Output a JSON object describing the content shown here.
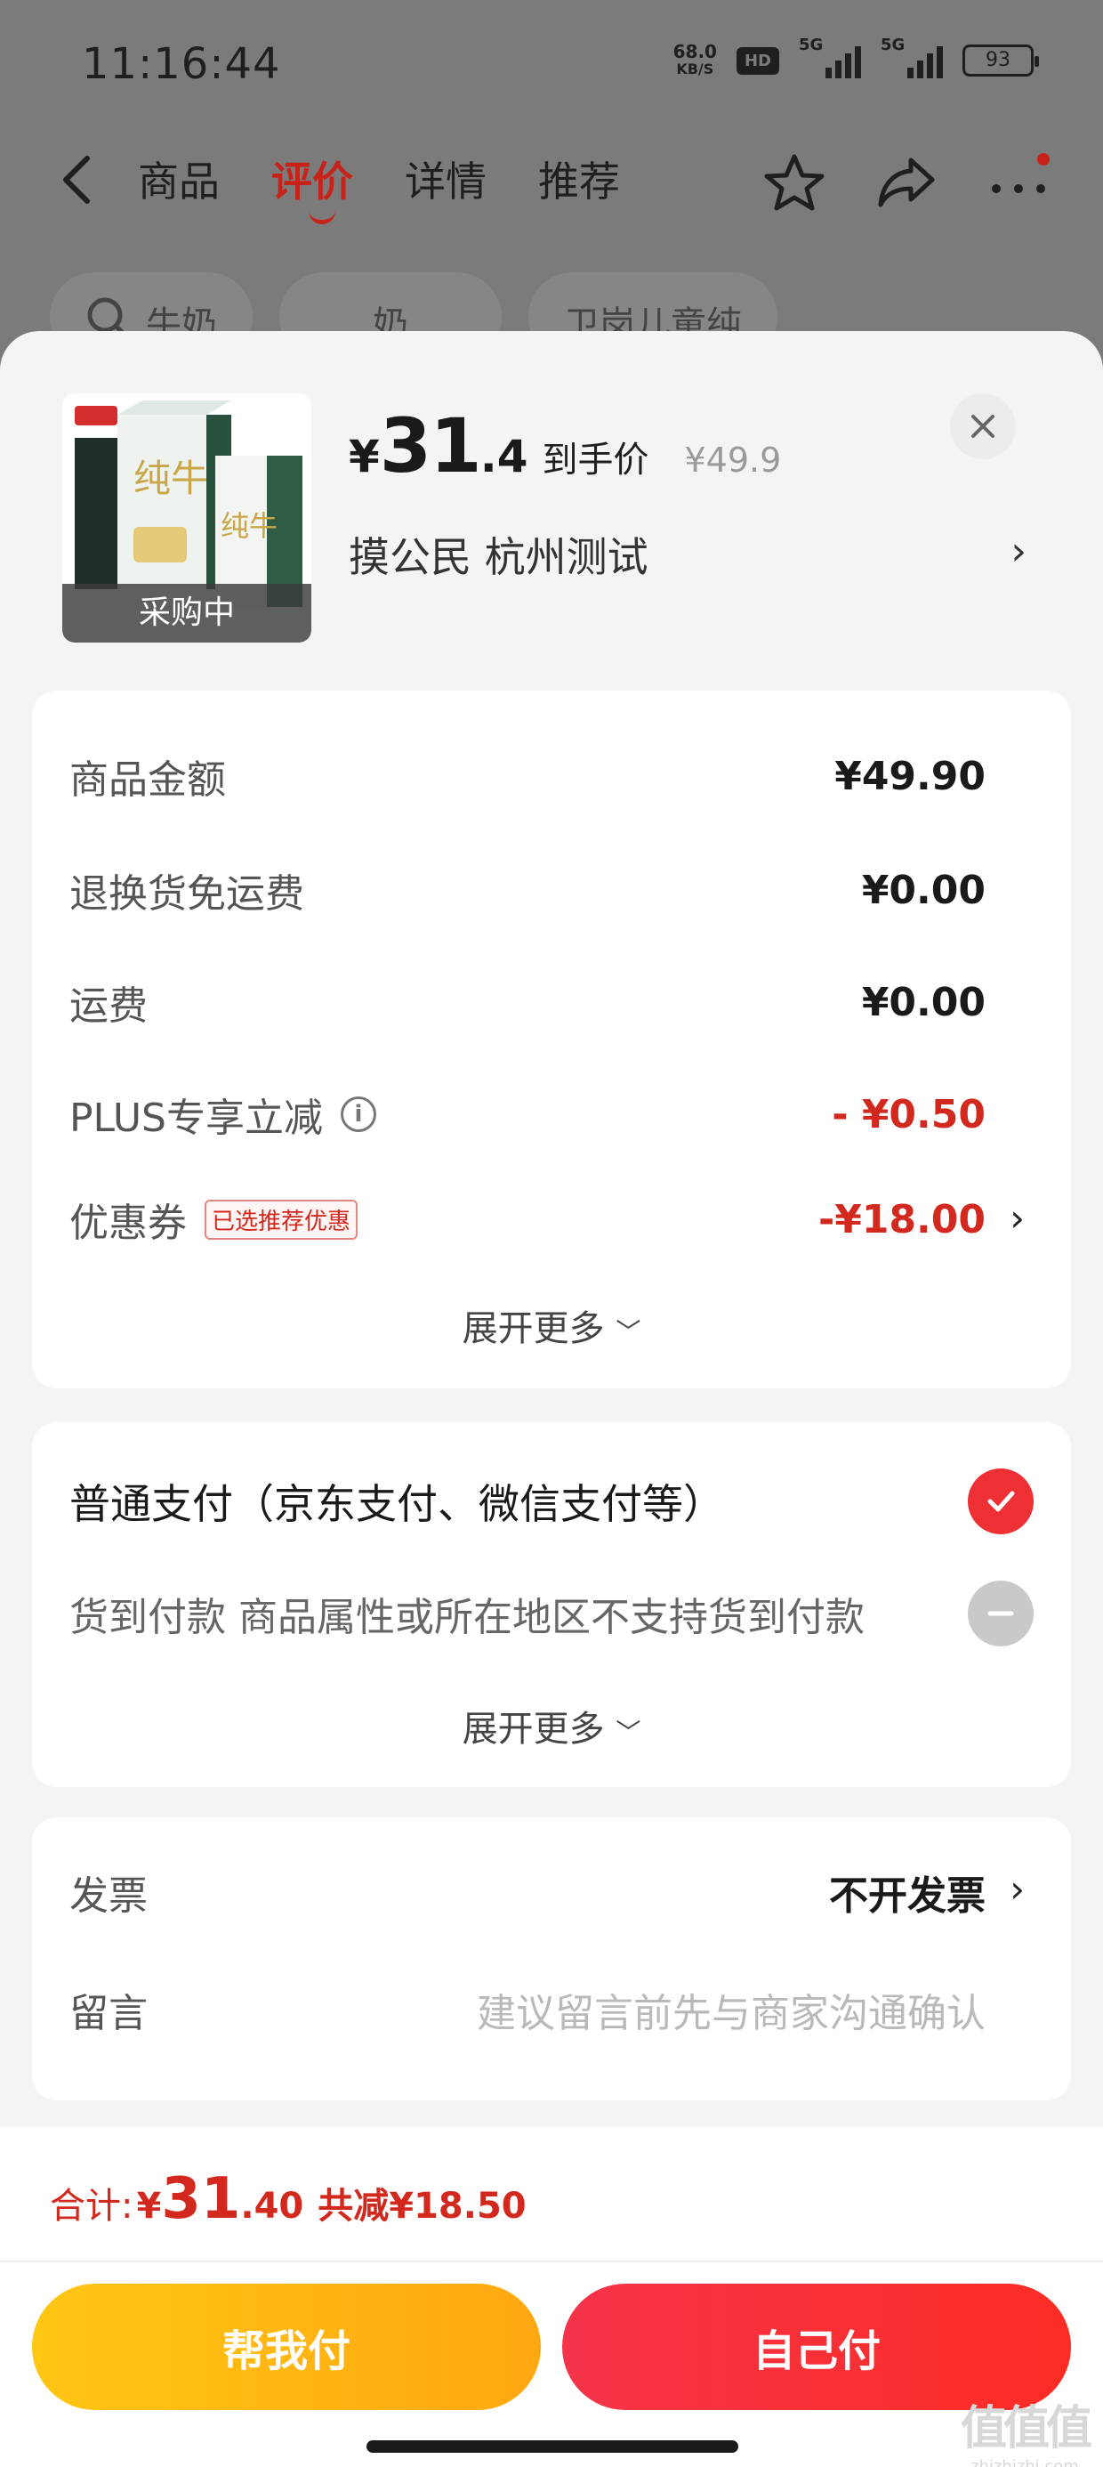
{
  "status_bar": {
    "time": "11:16:44",
    "net_speed_value": "68.0",
    "net_speed_unit": "KB/S",
    "hd_label": "HD",
    "sim1_label": "5G",
    "sim2_label": "5G",
    "battery": "93"
  },
  "nav": {
    "tabs": [
      {
        "label": "商品"
      },
      {
        "label": "评价"
      },
      {
        "label": "详情"
      },
      {
        "label": "推荐"
      }
    ],
    "active_tab": "评价"
  },
  "chips": [
    {
      "label": "牛奶"
    },
    {
      "label": "奶"
    },
    {
      "label": "卫岗儿童纯"
    }
  ],
  "product": {
    "badge": "采购中",
    "price_symbol": "¥",
    "price_int": "31",
    "price_dec": ".4",
    "price_tag": "到手价",
    "original_price": "¥49.9",
    "address": "摸公民  杭州测试"
  },
  "cost_card": {
    "rows": [
      {
        "label": "商品金额",
        "value": "¥49.90"
      },
      {
        "label": "退换货免运费",
        "value": "¥0.00"
      },
      {
        "label": "运费",
        "value": "¥0.00"
      },
      {
        "label": "PLUS专享立减",
        "value": "- ¥0.50"
      },
      {
        "label": "优惠券",
        "value": "-¥18.00"
      }
    ],
    "coupon_tag": "已选推荐优惠",
    "expand_label": "展开更多"
  },
  "payment_card": {
    "options": [
      {
        "label": "普通支付（京东支付、微信支付等）"
      },
      {
        "label": "货到付款  商品属性或所在地区不支持货到付款"
      }
    ],
    "expand_label": "展开更多"
  },
  "extra_card": {
    "invoice_label": "发票",
    "invoice_value": "不开发票",
    "memo_label": "留言",
    "memo_placeholder": "建议留言前先与商家沟通确认"
  },
  "footer": {
    "total_label": "合计:",
    "total_symbol": "¥",
    "total_int": "31",
    "total_dec": ".40",
    "total_save": "共减¥18.50",
    "help_pay_label": "帮我付",
    "self_pay_label": "自己付"
  },
  "watermark": {
    "main": "值值值",
    "sub": "zhizhizhi.com"
  },
  "colors": {
    "accent_red": "#d2281e",
    "check_red": "#ee2f33",
    "help_btn_yellow": "#ffb812",
    "self_btn_red": "#f5334a"
  }
}
